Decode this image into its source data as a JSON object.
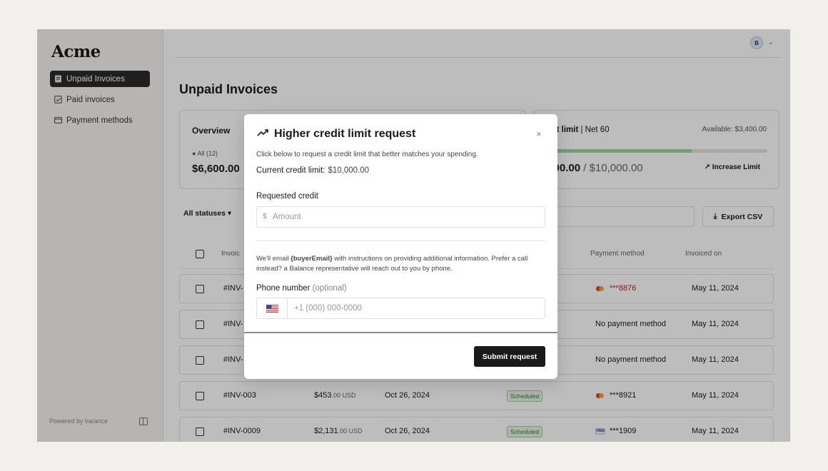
{
  "sidebar": {
    "logo": "Acme",
    "items": [
      {
        "label": "Unpaid Invoices"
      },
      {
        "label": "Paid invoices"
      },
      {
        "label": "Payment methods"
      }
    ],
    "powered_by": "Powered by ba/ance"
  },
  "header": {
    "avatar_initial": "B"
  },
  "main": {
    "title": "Unpaid Invoices",
    "overview": {
      "title": "Overview",
      "all_label": "● All (12)",
      "amount": "$6,600.00"
    },
    "credit": {
      "title_bold": "edit limit",
      "title_rest": " | Net 60",
      "available": "Available: $3,400.00",
      "used_bold": ",600.00",
      "used_rest": " / $10,000.00",
      "used_fraction": 0.66,
      "increase_label": "Increase Limit"
    },
    "filter_label": "All statuses",
    "export_label": "Export CSV",
    "columns": {
      "invoice": "Invoic",
      "payment_method": "Payment method",
      "invoiced_on": "Invoiced on"
    },
    "rows": [
      {
        "id": "#INV-",
        "amount": "",
        "cents": "",
        "due": "",
        "status": "",
        "payment": "***8876",
        "card": "mc",
        "invoiced": "May 11, 2024"
      },
      {
        "id": "#INV-",
        "amount": "",
        "cents": "",
        "due": "",
        "status": "",
        "payment": "No payment method",
        "card": "",
        "invoiced": "May 11, 2024"
      },
      {
        "id": "#INV-",
        "amount": "",
        "cents": "",
        "due": "",
        "status": "",
        "payment": "No payment method",
        "card": "",
        "invoiced": "May 11, 2024"
      },
      {
        "id": "#INV-003",
        "amount": "$453",
        "cents": ".00 USD",
        "due": "Oct 26, 2024",
        "status": "Scheduled",
        "payment": "***8921",
        "card": "mc",
        "invoiced": "May 11, 2024"
      },
      {
        "id": "#INV-0009",
        "amount": "$2,131",
        "cents": ".00 USD",
        "due": "Oct 26, 2024",
        "status": "Scheduled",
        "payment": "***1909",
        "card": "visa",
        "invoiced": "May 11, 2024"
      }
    ]
  },
  "modal": {
    "title": "Higher credit limit request",
    "close": "×",
    "description": "Click below to request a credit limit that better matches your spending.",
    "current_label": "Current credit limit:",
    "current_value": "$10,000.00",
    "requested_label": "Requested credit",
    "currency_symbol": "$",
    "amount_placeholder": "Amount",
    "info_prefix": "We'll email ",
    "info_email": "{buyerEmail}",
    "info_rest": " with instructions on providing additional information. Prefer a call instead? a Balance representative will reach out to you by phone.",
    "phone_label": "Phone number",
    "phone_optional": "(optional)",
    "phone_placeholder": "+1 (000) 000-0000",
    "submit_label": "Submit request"
  },
  "colors": {
    "accent": "#1a1a1a",
    "progress": "#9ed39b",
    "scheduled": "#2f7a3a",
    "error": "#b42318"
  }
}
